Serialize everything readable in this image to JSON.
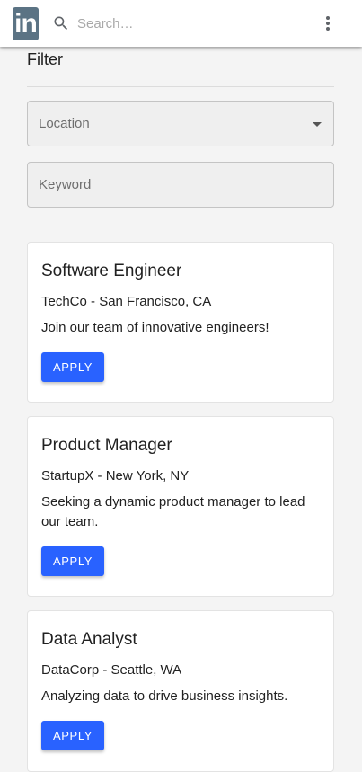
{
  "header": {
    "logo_text": "in",
    "search_placeholder": "Search…"
  },
  "filter": {
    "title": "Filter",
    "location_label": "Location",
    "keyword_placeholder": "Keyword"
  },
  "jobs": [
    {
      "title": "Software Engineer",
      "company": "TechCo - San Francisco, CA",
      "description": "Join our team of innovative engineers!",
      "apply_label": "APPLY"
    },
    {
      "title": "Product Manager",
      "company": "StartupX - New York, NY",
      "description": "Seeking a dynamic product manager to lead our team.",
      "apply_label": "APPLY"
    },
    {
      "title": "Data Analyst",
      "company": "DataCorp - Seattle, WA",
      "description": "Analyzing data to drive business insights.",
      "apply_label": "APPLY"
    }
  ],
  "colors": {
    "accent": "#2962ff",
    "logo_bg": "#5b7384"
  }
}
